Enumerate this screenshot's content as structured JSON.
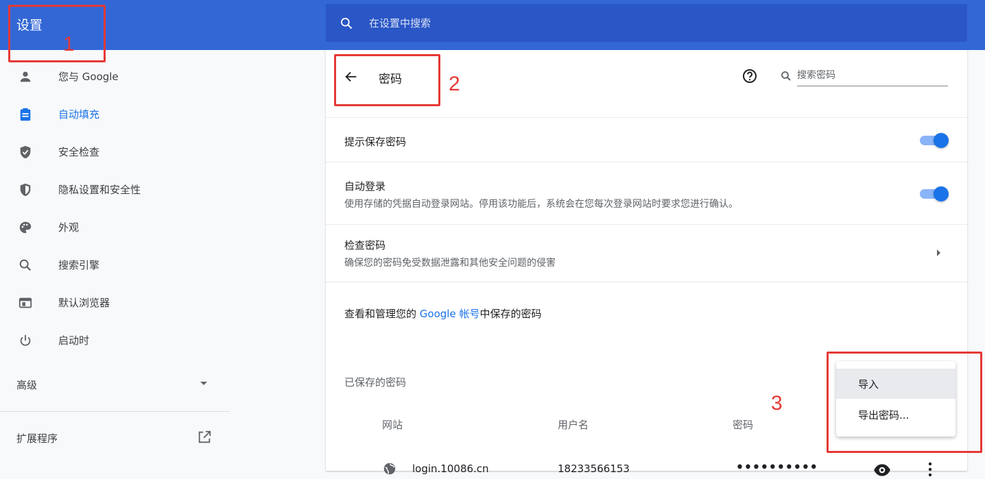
{
  "header": {
    "title": "设置",
    "search_placeholder": "在设置中搜索"
  },
  "sidebar": {
    "items": [
      {
        "label": "您与 Google",
        "icon": "person-icon"
      },
      {
        "label": "自动填充",
        "icon": "clipboard-icon",
        "active": true
      },
      {
        "label": "安全检查",
        "icon": "shield-check-icon"
      },
      {
        "label": "隐私设置和安全性",
        "icon": "privacy-shield-icon"
      },
      {
        "label": "外观",
        "icon": "palette-icon"
      },
      {
        "label": "搜索引擎",
        "icon": "search-icon"
      },
      {
        "label": "默认浏览器",
        "icon": "browser-window-icon"
      },
      {
        "label": "启动时",
        "icon": "power-icon"
      }
    ],
    "advanced_label": "高级",
    "extensions_label": "扩展程序"
  },
  "passwords_page": {
    "title": "密码",
    "search_placeholder": "搜索密码",
    "offer_to_save": {
      "label": "提示保存密码",
      "enabled": true
    },
    "auto_signin": {
      "label": "自动登录",
      "description": "使用存储的凭据自动登录网站。停用该功能后，系统会在您每次登录网站时要求您进行确认。",
      "enabled": true
    },
    "check_passwords": {
      "label": "检查密码",
      "description": "确保您的密码免受数据泄露和其他安全问题的侵害"
    },
    "manage": {
      "prefix": "查看和管理您的 ",
      "link": "Google 帐号",
      "suffix": "中保存的密码"
    },
    "saved_title": "已保存的密码",
    "columns": {
      "site": "网站",
      "username": "用户名",
      "password": "密码"
    },
    "rows": [
      {
        "site": "login.10086.cn",
        "username": "18233566153",
        "password_mask": "••••••••••"
      }
    ]
  },
  "menu": {
    "items": [
      {
        "label": "导入"
      },
      {
        "label": "导出密码..."
      }
    ]
  },
  "annotations": {
    "n1": "1",
    "n2": "2",
    "n3": "3"
  },
  "colors": {
    "header_blue": "#3367d6",
    "search_blue": "#2a56c6",
    "accent": "#1a73e8",
    "annotation_red": "#e53935"
  }
}
